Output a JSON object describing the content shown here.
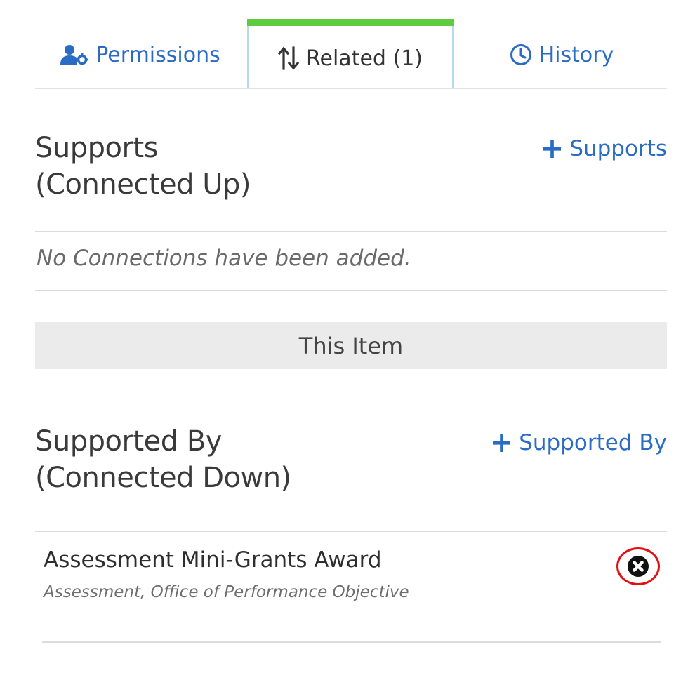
{
  "tabs": [
    {
      "label": "Permissions",
      "icon": "user-gear-icon"
    },
    {
      "label": "Related (1)",
      "icon": "sort-arrows-icon",
      "active": true
    },
    {
      "label": "History",
      "icon": "clock-icon"
    }
  ],
  "supports": {
    "title_line1": "Supports",
    "title_line2": "(Connected Up)",
    "add_label": "Supports",
    "empty_message": "No Connections have been added."
  },
  "this_item": {
    "label": "This Item"
  },
  "supported_by": {
    "title_line1": "Supported By",
    "title_line2": "(Connected Down)",
    "add_label": "Supported By",
    "items": [
      {
        "title": "Assessment Mini-Grants Award",
        "subtitle": "Assessment, Office of Performance Objective"
      }
    ]
  },
  "colors": {
    "link_blue": "#2a6cc4",
    "active_tab_bar": "#5fcb3e",
    "active_tab_border": "#b9d9ef",
    "highlight_red": "#e21010",
    "this_item_bg": "#ebebeb"
  }
}
